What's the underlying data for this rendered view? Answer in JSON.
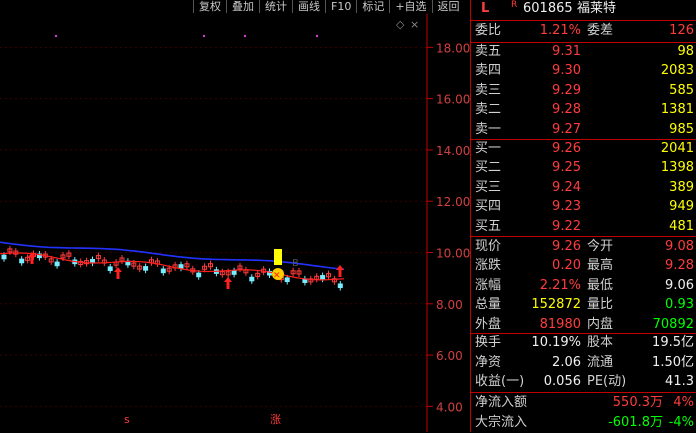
{
  "toolbar": {
    "items": [
      "复权",
      "叠加",
      "统计",
      "画线",
      "F10",
      "标记",
      "+自选",
      "返回"
    ]
  },
  "chart": {
    "price_ticks": [
      "18.00",
      "16.00",
      "14.00",
      "12.00",
      "10.00",
      "8.00",
      "6.00",
      "4.00"
    ],
    "diamond_marker": "◇",
    "bottom_markers": [
      "s",
      "涨"
    ],
    "label_b": "B"
  },
  "chart_data": {
    "type": "candlestick",
    "ylim": [
      3.0,
      19.3
    ],
    "y_ticks": [
      18,
      16,
      14,
      12,
      10,
      8,
      6,
      4
    ],
    "last_close": 9.26,
    "ma_blue_start": 10.4,
    "ma_blue_end": 9.4,
    "ma_red_level": 8.9
  },
  "quote": {
    "header_mark_l": "L",
    "header_mark_r": "R",
    "code": "601865",
    "name": "福莱特",
    "weibi_label": "委比",
    "weibi_value": "1.21%",
    "weicha_label": "委差",
    "weicha_value": "126",
    "sell": [
      {
        "label": "卖五",
        "price": "9.31",
        "vol": "98"
      },
      {
        "label": "卖四",
        "price": "9.30",
        "vol": "2083"
      },
      {
        "label": "卖三",
        "price": "9.29",
        "vol": "585"
      },
      {
        "label": "卖二",
        "price": "9.28",
        "vol": "1381"
      },
      {
        "label": "卖一",
        "price": "9.27",
        "vol": "985"
      }
    ],
    "buy": [
      {
        "label": "买一",
        "price": "9.26",
        "vol": "2041"
      },
      {
        "label": "买二",
        "price": "9.25",
        "vol": "1398"
      },
      {
        "label": "买三",
        "price": "9.24",
        "vol": "389"
      },
      {
        "label": "买四",
        "price": "9.23",
        "vol": "949"
      },
      {
        "label": "买五",
        "price": "9.22",
        "vol": "481"
      }
    ],
    "stats": [
      {
        "l1": "现价",
        "v1": "9.26",
        "l2": "今开",
        "v2": "9.08"
      },
      {
        "l1": "涨跌",
        "v1": "0.20",
        "l2": "最高",
        "v2": "9.28"
      },
      {
        "l1": "涨幅",
        "v1": "2.21%",
        "l2": "最低",
        "v2": "9.06"
      },
      {
        "l1": "总量",
        "v1": "152872",
        "l2": "量比",
        "v2": "0.93"
      },
      {
        "l1": "外盘",
        "v1": "81980",
        "l2": "内盘",
        "v2": "70892"
      }
    ],
    "fund": [
      {
        "l1": "换手",
        "v1": "10.19%",
        "l2": "股本",
        "v2": "19.5亿"
      },
      {
        "l1": "净资",
        "v1": "2.06",
        "l2": "流通",
        "v2": "1.50亿"
      },
      {
        "l1": "收益(一)",
        "v1": "0.056",
        "l2": "PE(动)",
        "v2": "41.3"
      }
    ],
    "flow": [
      {
        "label": "净流入额",
        "value": "550.3万",
        "pct": "4%"
      },
      {
        "label": "大宗流入",
        "value": "-601.8万",
        "pct": "-4%"
      }
    ]
  },
  "colors": {
    "up": "#ff3c3c",
    "down": "#00ff00",
    "flat": "#ffff00",
    "border": "#c00000",
    "ma_blue": "#2233ff",
    "ma_red": "#ff2020"
  }
}
